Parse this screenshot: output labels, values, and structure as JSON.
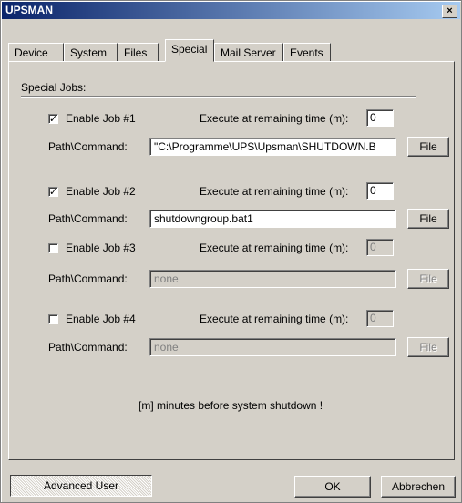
{
  "window": {
    "title": "UPSMAN",
    "close_glyph": "×"
  },
  "tabs": [
    "Device",
    "System",
    "Files",
    "Special",
    "Mail Server",
    "Events"
  ],
  "active_tab": "Special",
  "section_label": "Special Jobs:",
  "jobs": [
    {
      "label": "Enable Job #1",
      "checked": true,
      "time_label": "Execute at remaining time (m):",
      "time_value": "0",
      "path_label": "Path\\Command:",
      "path_value": "\"C:\\Programme\\UPS\\Upsman\\SHUTDOWN.B",
      "file_label": "File",
      "enabled": true
    },
    {
      "label": "Enable Job #2",
      "checked": true,
      "time_label": "Execute at remaining time (m):",
      "time_value": "0",
      "path_label": "Path\\Command:",
      "path_value": "shutdowngroup.bat1",
      "file_label": "File",
      "enabled": true
    },
    {
      "label": "Enable Job #3",
      "checked": false,
      "time_label": "Execute at remaining time (m):",
      "time_value": "0",
      "path_label": "Path\\Command:",
      "path_value": "none",
      "file_label": "File",
      "enabled": false
    },
    {
      "label": "Enable Job #4",
      "checked": false,
      "time_label": "Execute at remaining time (m):",
      "time_value": "0",
      "path_label": "Path\\Command:",
      "path_value": "none",
      "file_label": "File",
      "enabled": false
    }
  ],
  "footnote": "[m] minutes before system shutdown !",
  "buttons": {
    "advanced": "Advanced User",
    "ok": "OK",
    "cancel": "Abbrechen"
  },
  "check_glyph": "✓"
}
